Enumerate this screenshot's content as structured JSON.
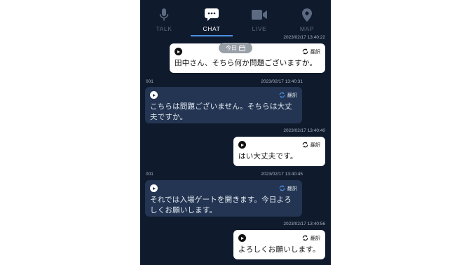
{
  "tabs": [
    {
      "label": "TALK",
      "icon": "microphone-icon",
      "active": false
    },
    {
      "label": "CHAT",
      "icon": "chat-bubble-icon",
      "active": true
    },
    {
      "label": "LIVE",
      "icon": "video-camera-icon",
      "active": false
    },
    {
      "label": "MAP",
      "icon": "map-pin-icon",
      "active": false
    }
  ],
  "date_pill": "今日",
  "translate_label": "翻訳",
  "messages": [
    {
      "direction": "out",
      "timestamp": "2023/02/17 13:40:22",
      "text": "田中さん、そちら何か問題ございますか。"
    },
    {
      "direction": "in",
      "sender": "001",
      "timestamp": "2023/02/17 13:40:31",
      "text": "こちらは問題ございません。そちらは大丈夫ですか。"
    },
    {
      "direction": "out",
      "timestamp": "2023/02/17 13:40:40",
      "text": "はい大丈夫です。"
    },
    {
      "direction": "in",
      "sender": "001",
      "timestamp": "2023/02/17 13:40:45",
      "text": "それでは入場ゲートを開きます。今日よろしくお願いします。"
    },
    {
      "direction": "out",
      "timestamp": "2023/02/17 13:40:56",
      "text": "よろしくお願いします。"
    }
  ],
  "colors": {
    "background": "#0f1a2d",
    "incoming_bubble": "#233552",
    "outgoing_bubble": "#ffffff",
    "accent": "#4a90e2"
  }
}
